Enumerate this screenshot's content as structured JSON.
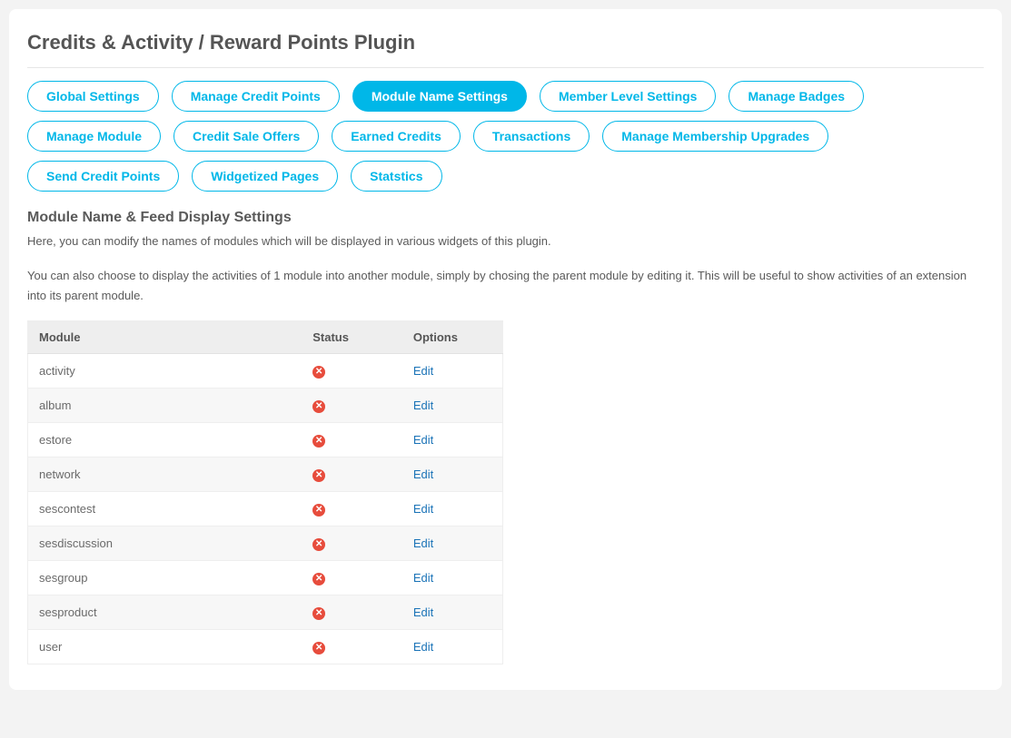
{
  "header": {
    "title": "Credits & Activity / Reward Points Plugin"
  },
  "tabs": [
    {
      "label": "Global Settings",
      "active": false
    },
    {
      "label": "Manage Credit Points",
      "active": false
    },
    {
      "label": "Module Name Settings",
      "active": true
    },
    {
      "label": "Member Level Settings",
      "active": false
    },
    {
      "label": "Manage Badges",
      "active": false
    },
    {
      "label": "Manage Module",
      "active": false
    },
    {
      "label": "Credit Sale Offers",
      "active": false
    },
    {
      "label": "Earned Credits",
      "active": false
    },
    {
      "label": "Transactions",
      "active": false
    },
    {
      "label": "Manage Membership Upgrades",
      "active": false
    },
    {
      "label": "Send Credit Points",
      "active": false
    },
    {
      "label": "Widgetized Pages",
      "active": false
    },
    {
      "label": "Statstics",
      "active": false
    }
  ],
  "section": {
    "heading": "Module Name & Feed Display Settings",
    "desc1": "Here, you can modify the names of modules which will be displayed in various widgets of this plugin.",
    "desc2": "You can also choose to display the activities of 1 module into another module, simply by chosing the parent module by editing it. This will be useful to show activities of an extension into its parent module."
  },
  "table": {
    "columns": {
      "module": "Module",
      "status": "Status",
      "options": "Options"
    },
    "editLabel": "Edit",
    "statusIconName": "cross-red-icon",
    "rows": [
      {
        "module": "activity"
      },
      {
        "module": "album"
      },
      {
        "module": "estore"
      },
      {
        "module": "network"
      },
      {
        "module": "sescontest"
      },
      {
        "module": "sesdiscussion"
      },
      {
        "module": "sesgroup"
      },
      {
        "module": "sesproduct"
      },
      {
        "module": "user"
      }
    ]
  }
}
